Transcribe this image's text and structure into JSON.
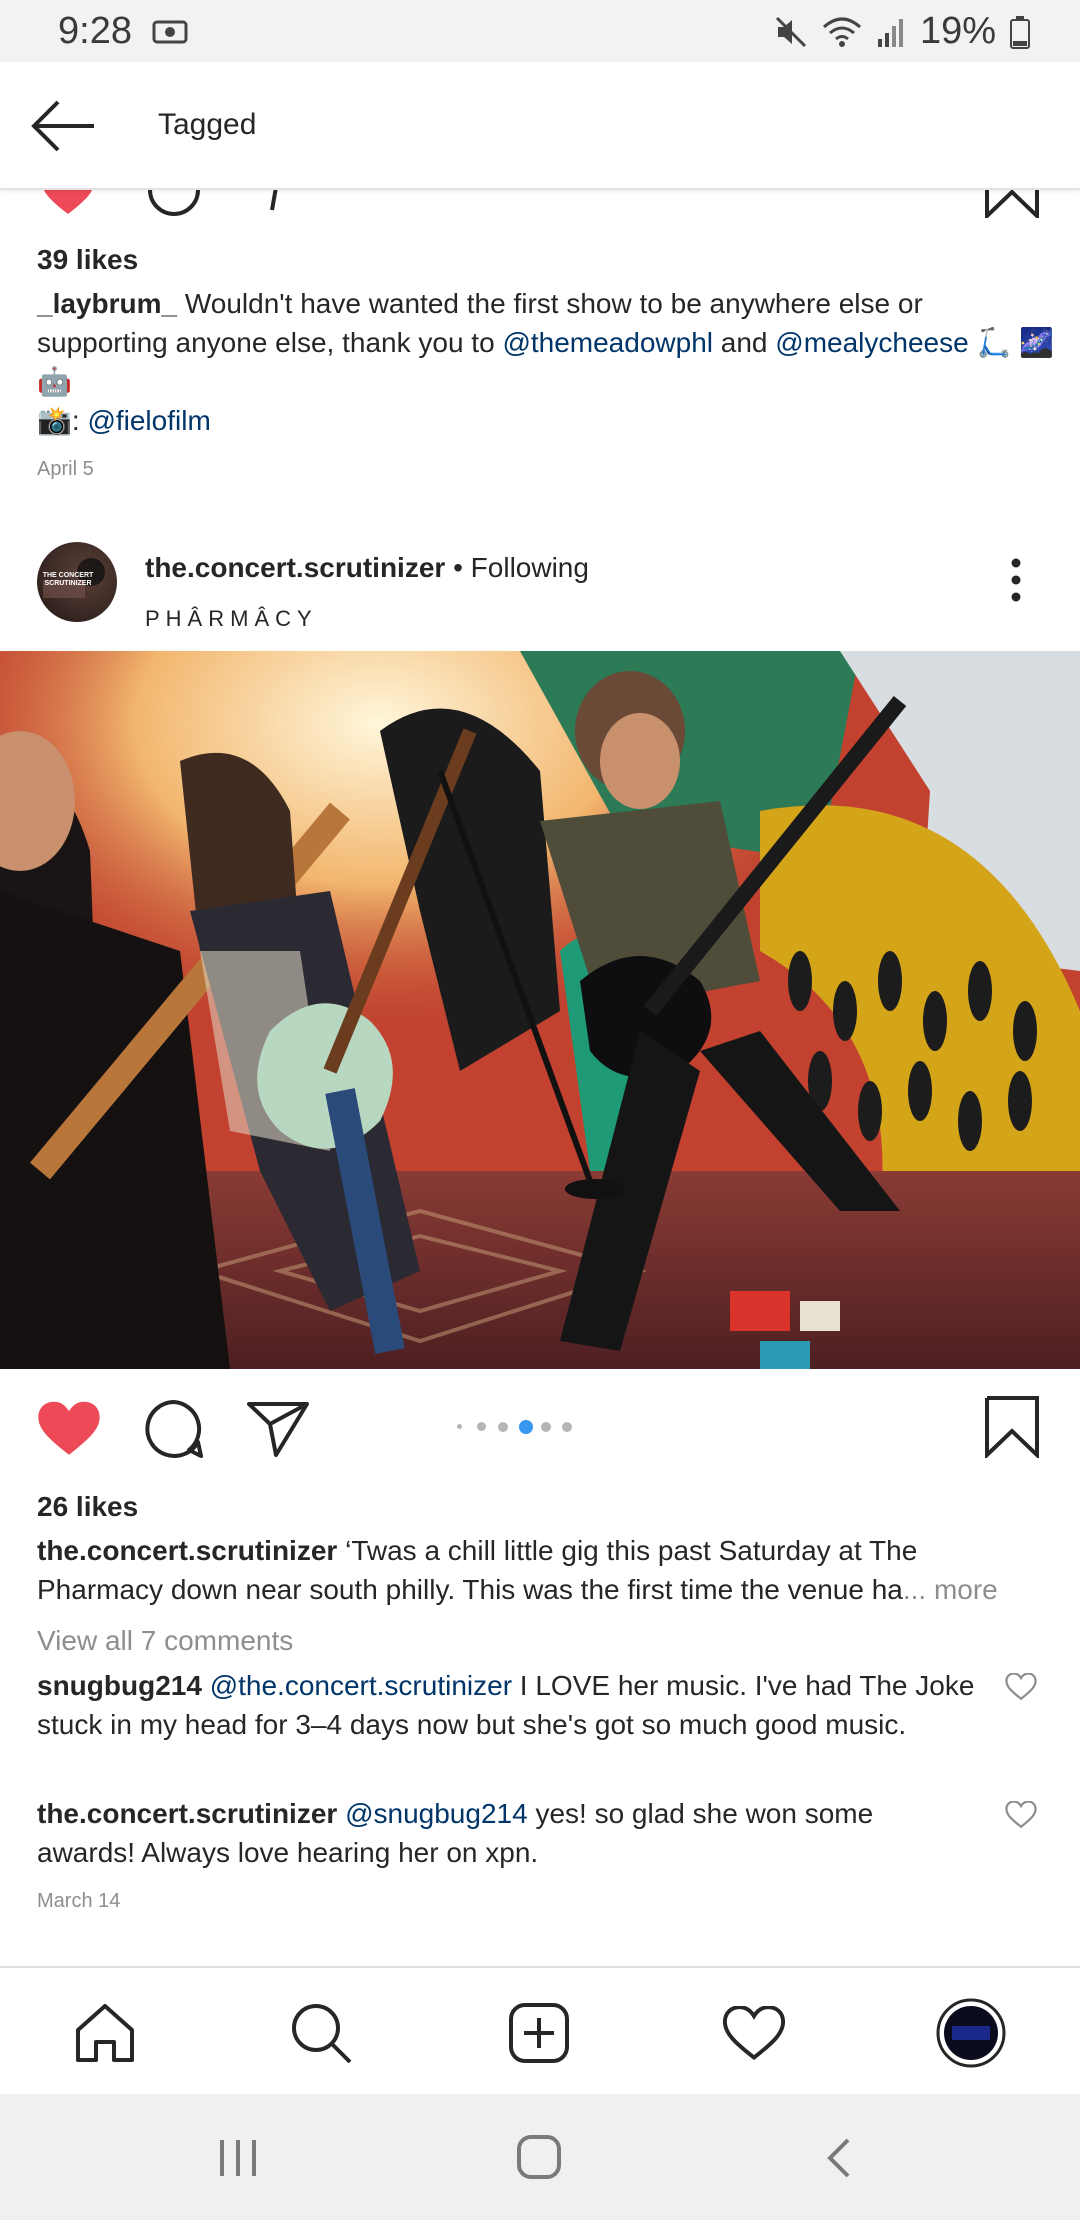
{
  "status_bar": {
    "time": "9:28",
    "battery": "19%",
    "icons": [
      "screenshot-icon",
      "mute-icon",
      "wifi-icon",
      "signal-icon",
      "battery-icon"
    ]
  },
  "header": {
    "title": "Tagged",
    "back_icon": "arrow-left-icon"
  },
  "post1": {
    "likes": "39 likes",
    "caption_user": "_laybrum_",
    "caption_pre": "Wouldn't have wanted the first show to be anywhere else or supporting anyone else, thank you to",
    "mention1": "@themeadowphl",
    "and": "and",
    "mention2": "@mealycheese",
    "emojis_line": "🛴 🌌🤖",
    "camera_prefix": "📸:",
    "camera_mention": "@fielofilm",
    "date": "April 5"
  },
  "post2": {
    "username": "the.concert.scrutinizer",
    "follow_status": "• Following",
    "location": "PHÂRMÂCY",
    "avatar_text": "THE CONCERT SCRUTINIZER",
    "carousel_total": 6,
    "carousel_active": 3,
    "likes": "26 likes",
    "caption_user": "the.concert.scrutinizer",
    "caption_text": "‘Twas a chill little gig this past Saturday at The Pharmacy down near south philly. This was the first time the venue ha",
    "more": "... more",
    "view_all": "View all 7 comments",
    "comments": [
      {
        "user": "snugbug214",
        "mention": "@the.concert.scrutinizer",
        "text": "I LOVE her music. I've had The Joke stuck in my head for 3–4 days now but she's got so much good music."
      },
      {
        "user": "the.concert.scrutinizer",
        "mention": "@snugbug214",
        "text": "yes! so glad she won some awards! Always love hearing her on xpn."
      }
    ],
    "date": "March 14"
  },
  "bottom_nav": [
    "home-icon",
    "search-icon",
    "add-post-icon",
    "activity-heart-icon",
    "profile-avatar"
  ],
  "system_nav": [
    "recent-apps-icon",
    "home-circle-icon",
    "back-chevron-icon"
  ],
  "colors": {
    "like_red": "#ed4956",
    "link_blue": "#003569",
    "carousel_active_blue": "#3897f0",
    "meta_grey": "#8e8e8e"
  }
}
